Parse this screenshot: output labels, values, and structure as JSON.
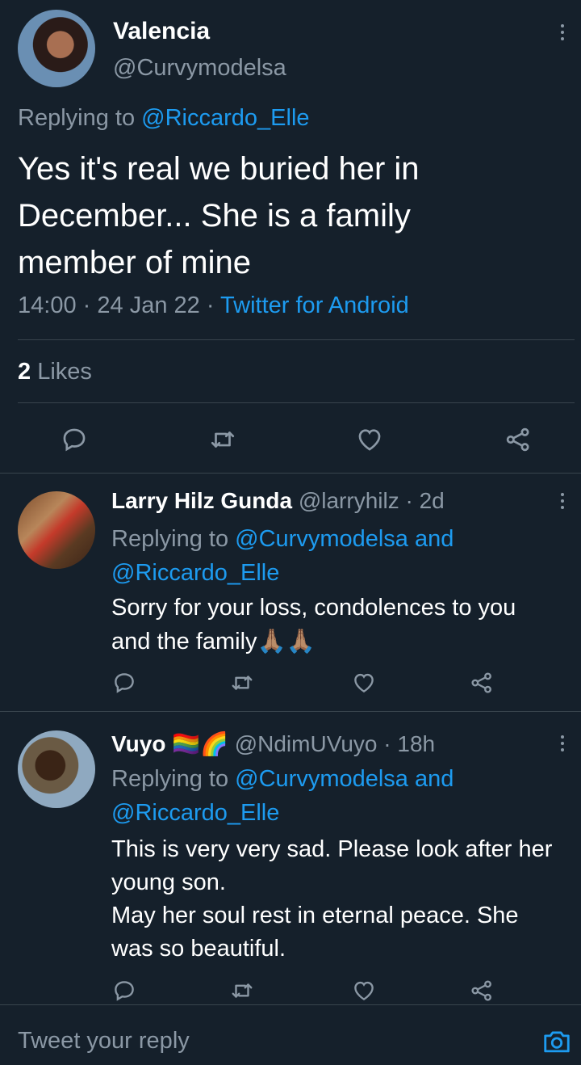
{
  "main_tweet": {
    "display_name": "Valencia",
    "handle": "@Curvymodelsa",
    "replying_prefix": "Replying to",
    "replying_to": "@Riccardo_Elle",
    "text_line1": "Yes it's real we buried her in",
    "text_line2": "December... She is a family",
    "text_line3": "member of mine",
    "time": "14:00",
    "sep1": "·",
    "date": "24 Jan 22",
    "sep2": "·",
    "source": "Twitter for Android",
    "likes_count": "2",
    "likes_label": "Likes"
  },
  "replies": [
    {
      "display_name": "Larry Hilz Gunda",
      "handle": "@larryhilz",
      "age": "· 2d",
      "replying_prefix": "Replying to",
      "replying_to_1": "@Curvymodelsa",
      "and": "and",
      "replying_to_2": "@Riccardo_Elle",
      "text_line1": "Sorry for your loss, condolences to you",
      "text_line2": "and the family",
      "emoji": "🙏🏽🙏🏽"
    },
    {
      "display_name": "Vuyo",
      "name_emoji": "🏳️‍🌈🌈",
      "handle": "@NdimUVuyo",
      "age": "· 18h",
      "replying_prefix": "Replying to",
      "replying_to_1": "@Curvymodelsa",
      "and": "and",
      "replying_to_2": "@Riccardo_Elle",
      "text_line1": "This is very very sad. Please look after her",
      "text_line2": "young son.",
      "text_line3": "May her soul rest in eternal peace. She",
      "text_line4": "was so beautiful."
    }
  ],
  "composer": {
    "placeholder": "Tweet your reply"
  },
  "icons": {
    "reply": "reply-icon",
    "retweet": "retweet-icon",
    "like": "heart-icon",
    "share": "share-icon",
    "more": "more-icon",
    "camera": "camera-icon"
  },
  "colors": {
    "background": "#15202b",
    "accent": "#1d9bf0",
    "muted": "#8b98a5",
    "divider": "#38444d"
  }
}
